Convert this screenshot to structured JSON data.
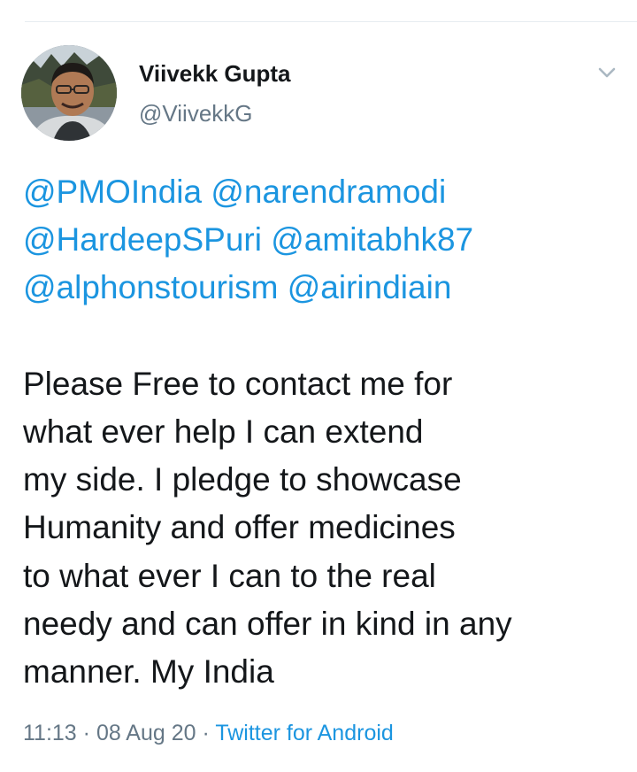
{
  "author": {
    "display_name": "Viivekk Gupta",
    "handle": "@ViivekkG"
  },
  "tweet": {
    "mentions_line1": [
      "@PMOIndia",
      "@narendramodi"
    ],
    "mentions_line2": [
      "@HardeepSPuri",
      "@amitabhk87"
    ],
    "mentions_line3": [
      "@alphonstourism",
      "@airindiain"
    ],
    "text_lines": [
      "Please Free to contact me for",
      "what ever help I can extend",
      "my side. I pledge to showcase",
      "Humanity and offer medicines",
      "to what ever I can to the real",
      "needy and can offer in kind in any",
      "manner. My India"
    ]
  },
  "meta": {
    "time": "11:13",
    "separator": " · ",
    "date": "08 Aug 20",
    "source": "Twitter for Android"
  },
  "colors": {
    "link": "#1b95e0",
    "secondary_text": "#657786",
    "primary_text": "#14171a"
  },
  "icons": {
    "menu": "chevron-down-icon"
  }
}
